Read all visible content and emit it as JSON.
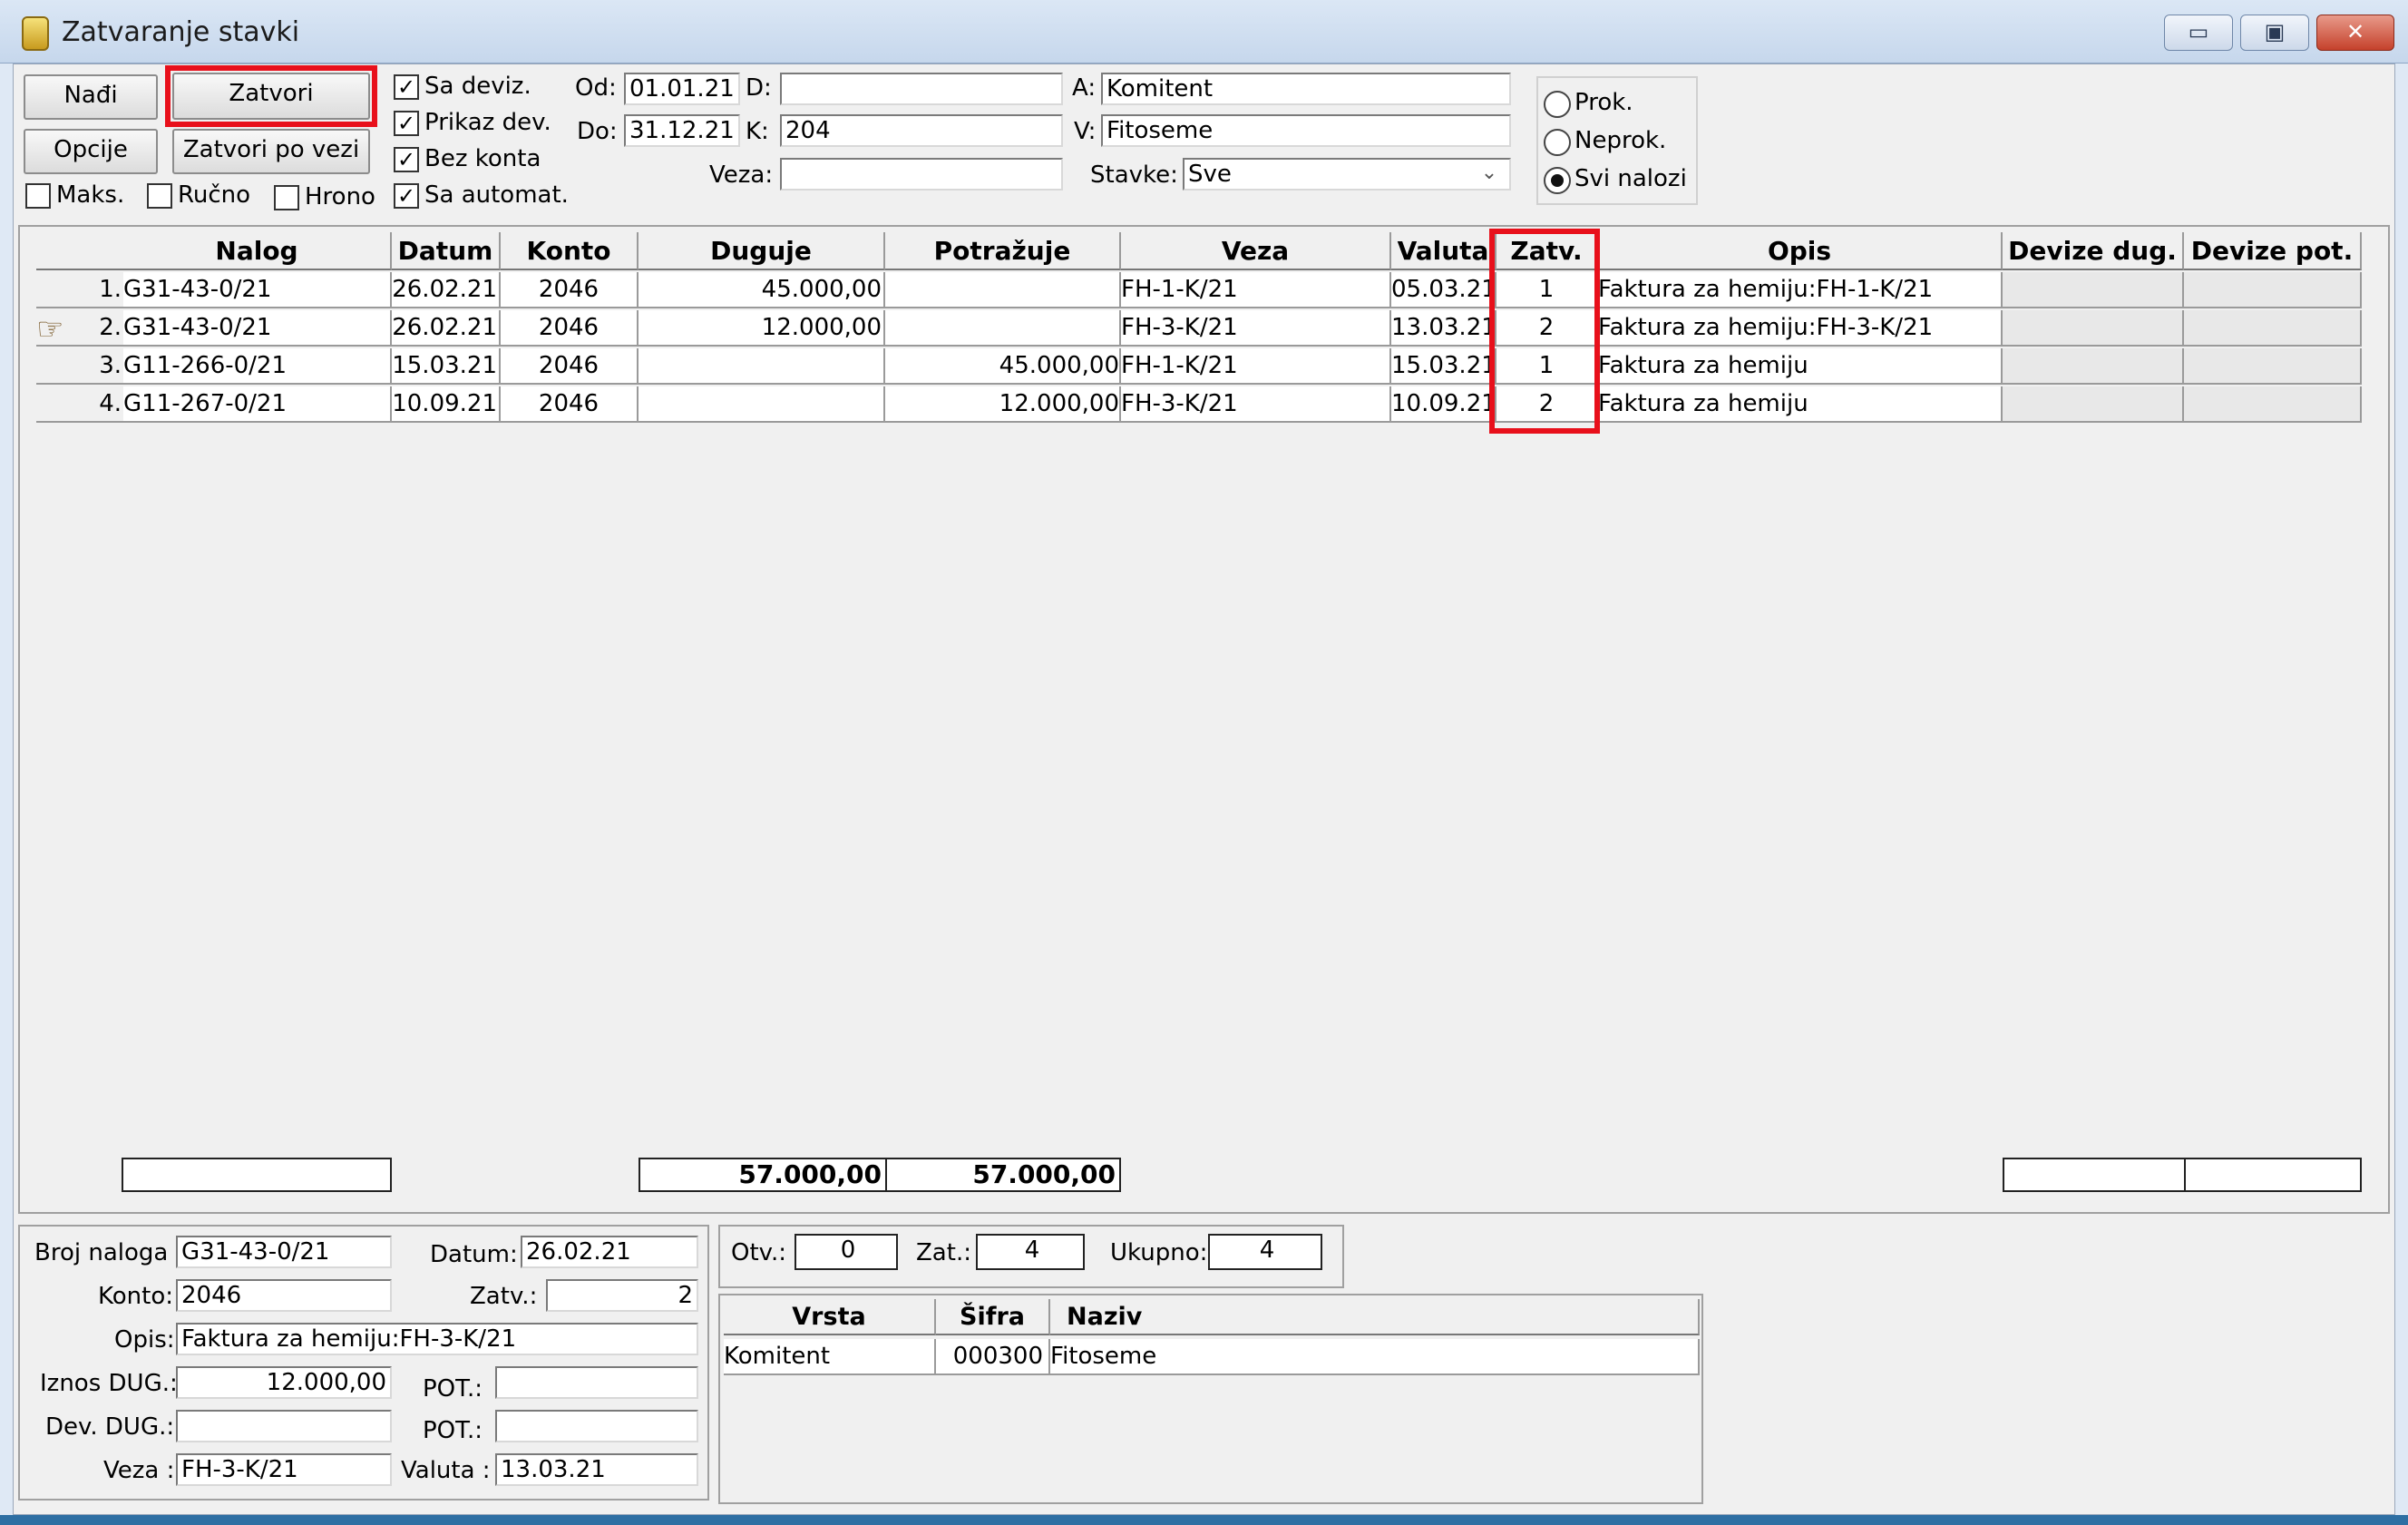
{
  "window": {
    "title": "Zatvaranje stavki",
    "min": "▭",
    "max": "▣",
    "close": "✕"
  },
  "toolbar": {
    "nadji": "Nađi",
    "zatvori": "Zatvori",
    "opcije": "Opcije",
    "zatvori_po_vezi": "Zatvori po vezi"
  },
  "checks": {
    "maks": {
      "label": "Maks.",
      "checked": false
    },
    "rucno": {
      "label": "Ručno",
      "checked": false
    },
    "hrono": {
      "label": "Hrono",
      "checked": false
    },
    "sa_deviz": {
      "label": "Sa deviz.",
      "checked": true
    },
    "prikaz_dev": {
      "label": "Prikaz dev.",
      "checked": true
    },
    "bez_konta": {
      "label": "Bez konta",
      "checked": true
    },
    "sa_automat": {
      "label": "Sa automat.",
      "checked": true
    },
    "mark": "✓"
  },
  "filters": {
    "od_label": "Od:",
    "od": "01.01.21",
    "do_label": "Do:",
    "do": "31.12.21",
    "d_label": "D:",
    "d": "",
    "k_label": "K:",
    "k": "204",
    "veza_label": "Veza:",
    "veza": "",
    "a_label": "A:",
    "a": "Komitent",
    "v_label": "V:",
    "v": "Fitoseme",
    "stavke_label": "Stavke:",
    "stavke": "Sve"
  },
  "radios": {
    "prok": "Prok.",
    "neprok": "Neprok.",
    "svi": "Svi nalozi",
    "selected": "svi"
  },
  "grid": {
    "columns": [
      "Nalog",
      "Datum",
      "Konto",
      "Duguje",
      "Potražuje",
      "Veza",
      "Valuta",
      "Zatv.",
      "Opis",
      "Devize dug.",
      "Devize pot."
    ],
    "rows": [
      {
        "num": "1.",
        "nalog": "G31-43-0/21",
        "datum": "26.02.21",
        "konto": "2046",
        "duguje": "45.000,00",
        "potrazuje": "",
        "veza": "FH-1-K/21",
        "valuta": "05.03.21",
        "zatv": "1",
        "opis": "Faktura za hemiju:FH-1-K/21",
        "dev_dug": "",
        "dev_pot": ""
      },
      {
        "num": "2.",
        "nalog": "G31-43-0/21",
        "datum": "26.02.21",
        "konto": "2046",
        "duguje": "12.000,00",
        "potrazuje": "",
        "veza": "FH-3-K/21",
        "valuta": "13.03.21",
        "zatv": "2",
        "opis": "Faktura za hemiju:FH-3-K/21",
        "dev_dug": "",
        "dev_pot": ""
      },
      {
        "num": "3.",
        "nalog": "G11-266-0/21",
        "datum": "15.03.21",
        "konto": "2046",
        "duguje": "",
        "potrazuje": "45.000,00",
        "veza": "FH-1-K/21",
        "valuta": "15.03.21",
        "zatv": "1",
        "opis": "Faktura za hemiju",
        "dev_dug": "",
        "dev_pot": ""
      },
      {
        "num": "4.",
        "nalog": "G11-267-0/21",
        "datum": "10.09.21",
        "konto": "2046",
        "duguje": "",
        "potrazuje": "12.000,00",
        "veza": "FH-3-K/21",
        "valuta": "10.09.21",
        "zatv": "2",
        "opis": "Faktura za hemiju",
        "dev_dug": "",
        "dev_pot": ""
      }
    ],
    "current_row_pointer": "☞",
    "totals": {
      "nalog": "",
      "duguje": "57.000,00",
      "potrazuje": "57.000,00",
      "dev_dug": "",
      "dev_pot": ""
    }
  },
  "detail": {
    "broj_naloga_label": "Broj naloga :",
    "broj_naloga": "G31-43-0/21",
    "datum_label": "Datum:",
    "datum": "26.02.21",
    "konto_label": "Konto:",
    "konto": "2046",
    "zatv_label": "Zatv.:",
    "zatv": "2",
    "opis_label": "Opis:",
    "opis": "Faktura za hemiju:FH-3-K/21",
    "iznos_dug_label": "Iznos DUG.:",
    "iznos_dug": "12.000,00",
    "pot_label": "POT.:",
    "pot": "",
    "dev_dug_label": "Dev. DUG.:",
    "dev_dug": "",
    "dev_pot_label": "POT.:",
    "dev_pot": "",
    "veza_label": "Veza :",
    "veza": "FH-3-K/21",
    "valuta_label": "Valuta :",
    "valuta": "13.03.21"
  },
  "counts": {
    "otv_label": "Otv.:",
    "otv": "0",
    "zat_label": "Zat.:",
    "zat": "4",
    "ukupno_label": "Ukupno:",
    "ukupno": "4"
  },
  "analytic": {
    "columns": [
      "Vrsta",
      "Šifra",
      "Naziv"
    ],
    "rows": [
      {
        "vrsta": "Komitent",
        "sifra": "000300",
        "naziv": "Fitoseme"
      }
    ]
  },
  "colors": {
    "highlight": "#e8101b"
  }
}
